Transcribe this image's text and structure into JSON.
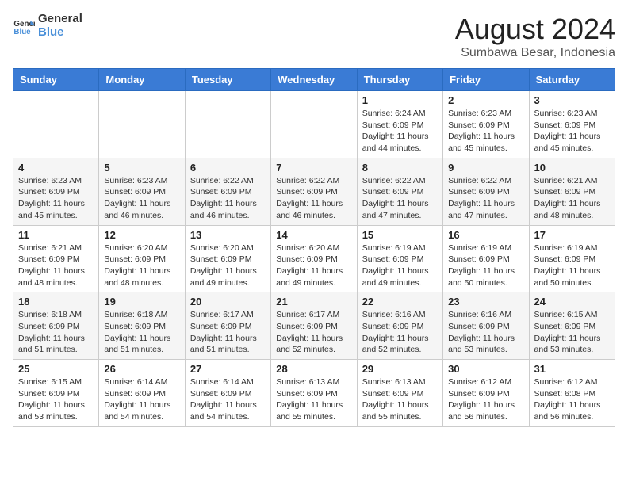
{
  "header": {
    "logo_line1": "General",
    "logo_line2": "Blue",
    "title": "August 2024",
    "subtitle": "Sumbawa Besar, Indonesia"
  },
  "weekdays": [
    "Sunday",
    "Monday",
    "Tuesday",
    "Wednesday",
    "Thursday",
    "Friday",
    "Saturday"
  ],
  "weeks": [
    [
      {
        "day": "",
        "sunrise": "",
        "sunset": "",
        "daylight": ""
      },
      {
        "day": "",
        "sunrise": "",
        "sunset": "",
        "daylight": ""
      },
      {
        "day": "",
        "sunrise": "",
        "sunset": "",
        "daylight": ""
      },
      {
        "day": "",
        "sunrise": "",
        "sunset": "",
        "daylight": ""
      },
      {
        "day": "1",
        "sunrise": "Sunrise: 6:24 AM",
        "sunset": "Sunset: 6:09 PM",
        "daylight": "Daylight: 11 hours and 44 minutes."
      },
      {
        "day": "2",
        "sunrise": "Sunrise: 6:23 AM",
        "sunset": "Sunset: 6:09 PM",
        "daylight": "Daylight: 11 hours and 45 minutes."
      },
      {
        "day": "3",
        "sunrise": "Sunrise: 6:23 AM",
        "sunset": "Sunset: 6:09 PM",
        "daylight": "Daylight: 11 hours and 45 minutes."
      }
    ],
    [
      {
        "day": "4",
        "sunrise": "Sunrise: 6:23 AM",
        "sunset": "Sunset: 6:09 PM",
        "daylight": "Daylight: 11 hours and 45 minutes."
      },
      {
        "day": "5",
        "sunrise": "Sunrise: 6:23 AM",
        "sunset": "Sunset: 6:09 PM",
        "daylight": "Daylight: 11 hours and 46 minutes."
      },
      {
        "day": "6",
        "sunrise": "Sunrise: 6:22 AM",
        "sunset": "Sunset: 6:09 PM",
        "daylight": "Daylight: 11 hours and 46 minutes."
      },
      {
        "day": "7",
        "sunrise": "Sunrise: 6:22 AM",
        "sunset": "Sunset: 6:09 PM",
        "daylight": "Daylight: 11 hours and 46 minutes."
      },
      {
        "day": "8",
        "sunrise": "Sunrise: 6:22 AM",
        "sunset": "Sunset: 6:09 PM",
        "daylight": "Daylight: 11 hours and 47 minutes."
      },
      {
        "day": "9",
        "sunrise": "Sunrise: 6:22 AM",
        "sunset": "Sunset: 6:09 PM",
        "daylight": "Daylight: 11 hours and 47 minutes."
      },
      {
        "day": "10",
        "sunrise": "Sunrise: 6:21 AM",
        "sunset": "Sunset: 6:09 PM",
        "daylight": "Daylight: 11 hours and 48 minutes."
      }
    ],
    [
      {
        "day": "11",
        "sunrise": "Sunrise: 6:21 AM",
        "sunset": "Sunset: 6:09 PM",
        "daylight": "Daylight: 11 hours and 48 minutes."
      },
      {
        "day": "12",
        "sunrise": "Sunrise: 6:20 AM",
        "sunset": "Sunset: 6:09 PM",
        "daylight": "Daylight: 11 hours and 48 minutes."
      },
      {
        "day": "13",
        "sunrise": "Sunrise: 6:20 AM",
        "sunset": "Sunset: 6:09 PM",
        "daylight": "Daylight: 11 hours and 49 minutes."
      },
      {
        "day": "14",
        "sunrise": "Sunrise: 6:20 AM",
        "sunset": "Sunset: 6:09 PM",
        "daylight": "Daylight: 11 hours and 49 minutes."
      },
      {
        "day": "15",
        "sunrise": "Sunrise: 6:19 AM",
        "sunset": "Sunset: 6:09 PM",
        "daylight": "Daylight: 11 hours and 49 minutes."
      },
      {
        "day": "16",
        "sunrise": "Sunrise: 6:19 AM",
        "sunset": "Sunset: 6:09 PM",
        "daylight": "Daylight: 11 hours and 50 minutes."
      },
      {
        "day": "17",
        "sunrise": "Sunrise: 6:19 AM",
        "sunset": "Sunset: 6:09 PM",
        "daylight": "Daylight: 11 hours and 50 minutes."
      }
    ],
    [
      {
        "day": "18",
        "sunrise": "Sunrise: 6:18 AM",
        "sunset": "Sunset: 6:09 PM",
        "daylight": "Daylight: 11 hours and 51 minutes."
      },
      {
        "day": "19",
        "sunrise": "Sunrise: 6:18 AM",
        "sunset": "Sunset: 6:09 PM",
        "daylight": "Daylight: 11 hours and 51 minutes."
      },
      {
        "day": "20",
        "sunrise": "Sunrise: 6:17 AM",
        "sunset": "Sunset: 6:09 PM",
        "daylight": "Daylight: 11 hours and 51 minutes."
      },
      {
        "day": "21",
        "sunrise": "Sunrise: 6:17 AM",
        "sunset": "Sunset: 6:09 PM",
        "daylight": "Daylight: 11 hours and 52 minutes."
      },
      {
        "day": "22",
        "sunrise": "Sunrise: 6:16 AM",
        "sunset": "Sunset: 6:09 PM",
        "daylight": "Daylight: 11 hours and 52 minutes."
      },
      {
        "day": "23",
        "sunrise": "Sunrise: 6:16 AM",
        "sunset": "Sunset: 6:09 PM",
        "daylight": "Daylight: 11 hours and 53 minutes."
      },
      {
        "day": "24",
        "sunrise": "Sunrise: 6:15 AM",
        "sunset": "Sunset: 6:09 PM",
        "daylight": "Daylight: 11 hours and 53 minutes."
      }
    ],
    [
      {
        "day": "25",
        "sunrise": "Sunrise: 6:15 AM",
        "sunset": "Sunset: 6:09 PM",
        "daylight": "Daylight: 11 hours and 53 minutes."
      },
      {
        "day": "26",
        "sunrise": "Sunrise: 6:14 AM",
        "sunset": "Sunset: 6:09 PM",
        "daylight": "Daylight: 11 hours and 54 minutes."
      },
      {
        "day": "27",
        "sunrise": "Sunrise: 6:14 AM",
        "sunset": "Sunset: 6:09 PM",
        "daylight": "Daylight: 11 hours and 54 minutes."
      },
      {
        "day": "28",
        "sunrise": "Sunrise: 6:13 AM",
        "sunset": "Sunset: 6:09 PM",
        "daylight": "Daylight: 11 hours and 55 minutes."
      },
      {
        "day": "29",
        "sunrise": "Sunrise: 6:13 AM",
        "sunset": "Sunset: 6:09 PM",
        "daylight": "Daylight: 11 hours and 55 minutes."
      },
      {
        "day": "30",
        "sunrise": "Sunrise: 6:12 AM",
        "sunset": "Sunset: 6:09 PM",
        "daylight": "Daylight: 11 hours and 56 minutes."
      },
      {
        "day": "31",
        "sunrise": "Sunrise: 6:12 AM",
        "sunset": "Sunset: 6:08 PM",
        "daylight": "Daylight: 11 hours and 56 minutes."
      }
    ]
  ]
}
